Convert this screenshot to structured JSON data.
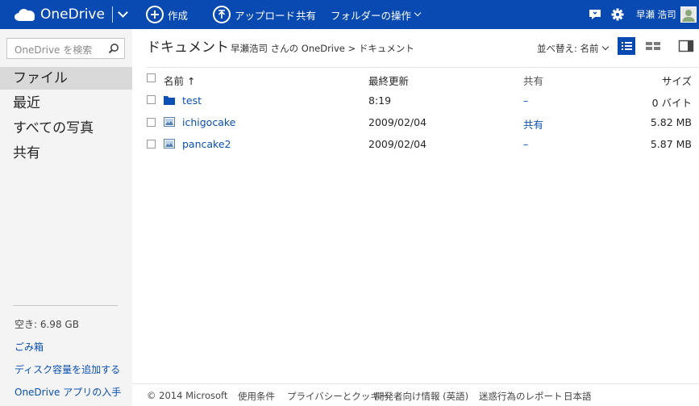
{
  "header": {
    "brand": "OneDrive",
    "commands": [
      {
        "label": "作成",
        "icon": "plus-icon"
      },
      {
        "label": "アップロード",
        "icon": "upload-icon"
      },
      {
        "label": "共有"
      },
      {
        "label": "フォルダーの操作",
        "icon": "chevron-down-icon"
      }
    ],
    "user_name": "早瀬 浩司",
    "colors": {
      "accent": "#094ab2"
    }
  },
  "sidebar": {
    "search_placeholder": "OneDrive を検索",
    "items": [
      {
        "label": "ファイル",
        "active": true
      },
      {
        "label": "最近"
      },
      {
        "label": "すべての写真"
      },
      {
        "label": "共有"
      }
    ],
    "storage": "空き: 6.98 GB",
    "links": [
      "ごみ箱",
      "ディスク容量を追加する",
      "OneDrive アプリの入手"
    ]
  },
  "main": {
    "title": "ドキュメント",
    "path": "早瀬浩司 さんの OneDrive > ドキュメント",
    "sort_label": "並べ替え: 名前",
    "columns": {
      "name": "名前 ↑",
      "modified": "最終更新",
      "shared": "共有",
      "size": "サイズ"
    },
    "rows": [
      {
        "name": "test",
        "type": "folder",
        "modified": "8:19",
        "shared": "–",
        "size": "0 バイト"
      },
      {
        "name": "ichigocake",
        "type": "image",
        "modified": "2009/02/04",
        "shared": "共有",
        "size": "5.82 MB"
      },
      {
        "name": "pancake2",
        "type": "image",
        "modified": "2009/02/04",
        "shared": "–",
        "size": "5.87 MB"
      }
    ]
  },
  "footer": {
    "items": [
      "© 2014 Microsoft",
      "使用条件",
      "プライバシーとクッキー",
      "開発者向け情報 (英語)",
      "迷惑行為のレポート",
      "日本語"
    ]
  }
}
